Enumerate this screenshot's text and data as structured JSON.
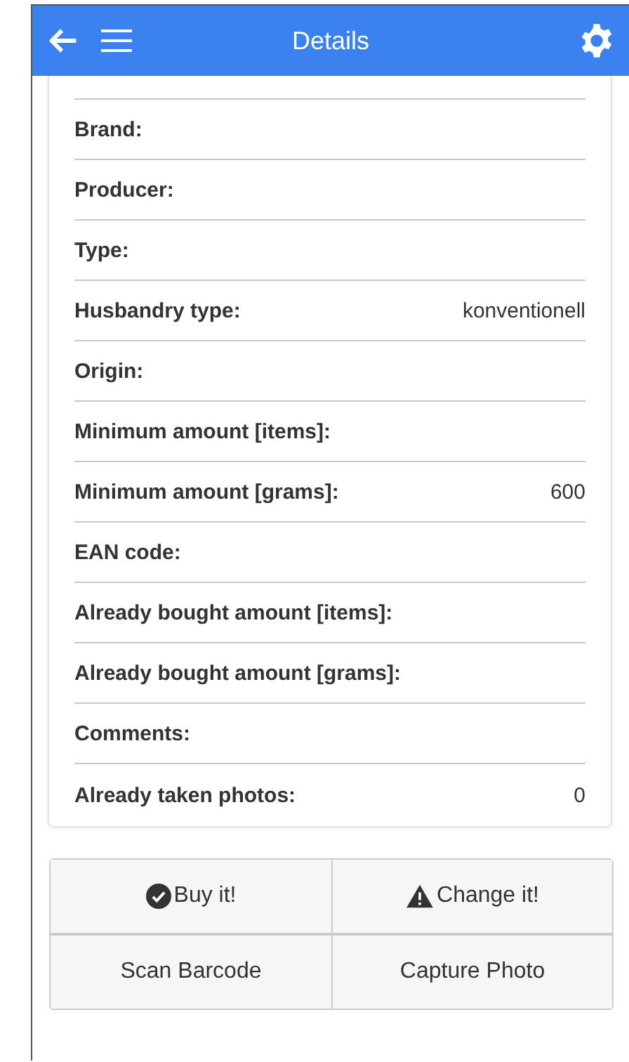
{
  "header": {
    "title": "Details"
  },
  "fields": [
    {
      "label": "Brand:"
    },
    {
      "label": "Producer:"
    },
    {
      "label": "Type:"
    },
    {
      "label": "Husbandry type:",
      "value": "konventionell"
    },
    {
      "label": "Origin:"
    },
    {
      "label": "Minimum amount [items]:"
    },
    {
      "label": "Minimum amount [grams]:",
      "value": "600"
    },
    {
      "label": "EAN code:"
    },
    {
      "label": "Already bought amount [items]:"
    },
    {
      "label": "Already bought amount [grams]:"
    },
    {
      "label": "Comments:"
    },
    {
      "label": "Already taken photos:",
      "value": "0"
    }
  ],
  "buttons": [
    {
      "label": "Buy it!",
      "kind": "confirm"
    },
    {
      "label": "Change it!",
      "kind": "alert"
    },
    {
      "label": "Scan Barcode",
      "kind": "plain"
    },
    {
      "label": "Capture Photo",
      "kind": "plain"
    }
  ]
}
